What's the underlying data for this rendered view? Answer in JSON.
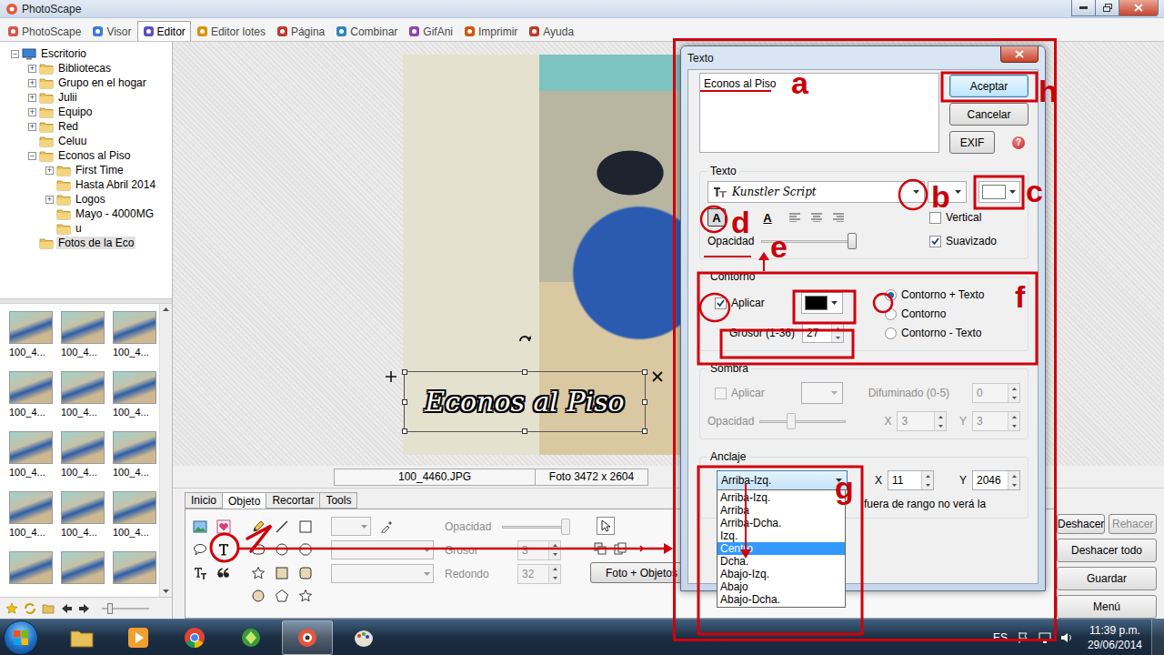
{
  "window": {
    "title": "PhotoScape"
  },
  "menu_tabs": [
    {
      "label": "PhotoScape",
      "selected": false
    },
    {
      "label": "Visor",
      "selected": false
    },
    {
      "label": "Editor",
      "selected": true
    },
    {
      "label": "Editor lotes",
      "selected": false
    },
    {
      "label": "Página",
      "selected": false
    },
    {
      "label": "Combinar",
      "selected": false
    },
    {
      "label": "GifAni",
      "selected": false
    },
    {
      "label": "Imprimir",
      "selected": false
    },
    {
      "label": "Ayuda",
      "selected": false
    }
  ],
  "tree": [
    {
      "label": "Escritorio",
      "depth": 0,
      "expander": "−",
      "selected": false
    },
    {
      "label": "Bibliotecas",
      "depth": 1,
      "expander": "+",
      "selected": false
    },
    {
      "label": "Grupo en el hogar",
      "depth": 1,
      "expander": "+",
      "selected": false
    },
    {
      "label": "Julii",
      "depth": 1,
      "expander": "+",
      "selected": false
    },
    {
      "label": "Equipo",
      "depth": 1,
      "expander": "+",
      "selected": false
    },
    {
      "label": "Red",
      "depth": 1,
      "expander": "+",
      "selected": false
    },
    {
      "label": "Celuu",
      "depth": 1,
      "expander": "",
      "selected": false
    },
    {
      "label": "Econos al Piso",
      "depth": 1,
      "expander": "−",
      "selected": false
    },
    {
      "label": "First Time",
      "depth": 2,
      "expander": "+",
      "selected": false
    },
    {
      "label": "Hasta Abril 2014",
      "depth": 2,
      "expander": "",
      "selected": false
    },
    {
      "label": "Logos",
      "depth": 2,
      "expander": "+",
      "selected": false
    },
    {
      "label": "Mayo - 4000MG",
      "depth": 2,
      "expander": "",
      "selected": false
    },
    {
      "label": "u",
      "depth": 2,
      "expander": "",
      "selected": false
    },
    {
      "label": "Fotos de la Eco",
      "depth": 1,
      "expander": "",
      "selected": true
    }
  ],
  "thumbnails": [
    {
      "label": "100_4..."
    },
    {
      "label": "100_4..."
    },
    {
      "label": "100_4..."
    },
    {
      "label": "100_4..."
    },
    {
      "label": "100_4..."
    },
    {
      "label": "100_4..."
    },
    {
      "label": "100_4..."
    },
    {
      "label": "100_4..."
    },
    {
      "label": "100_4..."
    },
    {
      "label": "100_4..."
    },
    {
      "label": "100_4..."
    },
    {
      "label": "100_4..."
    },
    {
      "label": ""
    },
    {
      "label": ""
    },
    {
      "label": ""
    }
  ],
  "editor": {
    "text_object": "Econos al Piso",
    "file_name": "100_4460.JPG",
    "photo_size": "Foto 3472 x 2604"
  },
  "editor_tabs": [
    {
      "label": "Inicio",
      "selected": false
    },
    {
      "label": "Objeto",
      "selected": true
    },
    {
      "label": "Recortar",
      "selected": false
    },
    {
      "label": "Tools",
      "selected": false
    }
  ],
  "object_panel": {
    "opacity": {
      "label": "Opacidad",
      "level": 1,
      "disabled": true
    },
    "thickness": {
      "label": "Grosor",
      "value": "3",
      "disabled": true
    },
    "round": {
      "label": "Redondo",
      "value": "32",
      "disabled": true
    },
    "photo_objects_button": "Foto + Objetos"
  },
  "side_buttons": [
    {
      "label": "Deshacer",
      "disabled": false
    },
    {
      "label": "Rehacer",
      "disabled": true
    },
    {
      "label": "Deshacer todo",
      "disabled": false
    },
    {
      "label": "Guardar",
      "disabled": false
    },
    {
      "label": "Menú",
      "disabled": false
    }
  ],
  "dialog": {
    "title": "Texto",
    "text": "Econos al Piso",
    "buttons": [
      {
        "label": "Aceptar",
        "default": true
      },
      {
        "label": "Cancelar",
        "default": false
      }
    ],
    "exif_button": "EXIF",
    "help": "?",
    "text_group": {
      "label": "Texto",
      "font": "Kunstler Script",
      "color": "#ffffff",
      "styles": [
        {
          "label": "A",
          "kind": "bold",
          "selected": true
        },
        {
          "label": "A",
          "kind": "underline",
          "selected": false
        }
      ],
      "vertical": {
        "label": "Vertical",
        "checked": false
      },
      "smooth": {
        "label": "Suavizado",
        "checked": true
      },
      "opacity": {
        "label": "Opacidad",
        "level": 1
      }
    },
    "outline": {
      "label": "Contorno",
      "apply": {
        "label": "Aplicar",
        "checked": true
      },
      "color": "#000000",
      "modes": [
        {
          "label": "Contorno + Texto",
          "selected": true
        },
        {
          "label": "Contorno",
          "selected": false
        },
        {
          "label": "Contorno - Texto",
          "selected": false
        }
      ],
      "thickness_label": "Grosor (1-36)",
      "thickness": "27"
    },
    "shadow": {
      "label": "Sombra",
      "disabled": true,
      "apply": {
        "label": "Aplicar",
        "checked": false
      },
      "blur_label": "Difuminado (0-5)",
      "blur": "0",
      "opacity_label": "Opacidad",
      "opacity_level": 0.35,
      "x_label": "X",
      "x": "3",
      "y_label": "Y",
      "y": "3"
    },
    "anchor": {
      "label": "Anclaje",
      "value": "Arriba-Izq.",
      "x_label": "X",
      "x": "11",
      "y_label": "Y",
      "y": "2046",
      "note": "fuera de rango no verá la",
      "options": [
        {
          "label": "Arriba-Izq.",
          "selected": false
        },
        {
          "label": "Arriba",
          "selected": false
        },
        {
          "label": "Arriba-Dcha.",
          "selected": false
        },
        {
          "label": "Izq.",
          "selected": false
        },
        {
          "label": "Centro",
          "selected": true
        },
        {
          "label": "Dcha.",
          "selected": false
        },
        {
          "label": "Abajo-Izq.",
          "selected": false
        },
        {
          "label": "Abajo",
          "selected": false
        },
        {
          "label": "Abajo-Dcha.",
          "selected": false
        }
      ]
    }
  },
  "annotations": [
    {
      "letter": "a"
    },
    {
      "letter": "b"
    },
    {
      "letter": "c"
    },
    {
      "letter": "d"
    },
    {
      "letter": "e"
    },
    {
      "letter": "f"
    },
    {
      "letter": "g"
    },
    {
      "letter": "h"
    }
  ],
  "taskbar": {
    "language": "ES",
    "time": "11:39 p.m.",
    "date": "29/06/2014"
  }
}
